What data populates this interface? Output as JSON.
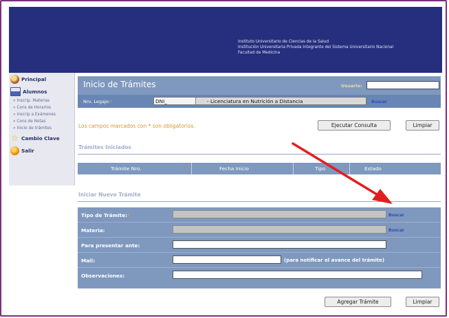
{
  "header": {
    "lines": [
      "Instituto Universitario de Ciencias de la Salud",
      "Institución Universitaria Privada Integrante del Sistema Universitario Nacional",
      "Facultad de Medicina"
    ]
  },
  "sidebar": {
    "principal": "Principal",
    "alumnos": "Alumnos",
    "sub_items": [
      "» Inscrip. Materias",
      "» Cons de Horarios",
      "» Inscrip a Exámenes",
      "» Cons de Notas",
      "» Inicio de trámites"
    ],
    "cambio_clave": "Cambio Clave",
    "salir": "Salir"
  },
  "main": {
    "title": "Inicio de Trámites",
    "usuario_label": "Usuario:",
    "usuario_value": "",
    "legajo_label": "Nro. Legajo:",
    "legajo_req": "*",
    "dni": "DNI_",
    "carrera": "- Licenciatura en Nutrición a Distancia",
    "buscar": "Buscar",
    "required_note": "Los campos marcados con * son obligatorios.",
    "ejecutar_btn": "Ejecutar Consulta",
    "limpiar_btn": "Limpiar",
    "tramites_iniciados": "Trámites Iniciados",
    "table_headers": [
      "Trámite Nro.",
      "Fecha Inicio",
      "Tipo",
      "Estado"
    ],
    "iniciar_nuevo": "Iniciar Nuevo Trámite",
    "form": {
      "tipo_label": "Tipo de Trámite:",
      "tipo_req": "*",
      "materia_label": "Materia:",
      "presentar_label": "Para presentar ante:",
      "mail_label": "Mail:",
      "mail_note": "(para notificar el avance del trámite)",
      "observaciones_label": "Observaciones:",
      "buscar": "Buscar"
    },
    "agregar_btn": "Agregar Trámite",
    "limpiar_btn2": "Limpiar"
  },
  "colors": {
    "header": "#262f7d",
    "panel": "#7f98be",
    "panel_dark": "#6786b3",
    "accent_orange": "#d79432",
    "arrow": "#e02020",
    "border": "#7a2f7e"
  }
}
